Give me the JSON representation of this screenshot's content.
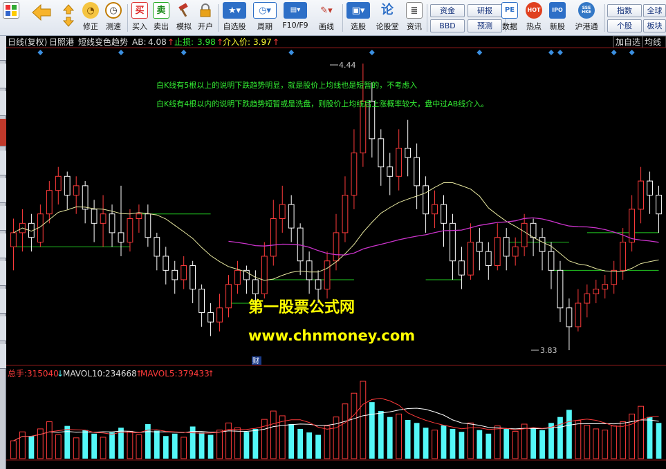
{
  "toolbar": {
    "buttons": [
      {
        "label": "",
        "icon": "window-icon"
      },
      {
        "label": "",
        "icon": "back-icon"
      },
      {
        "label": "修正",
        "icon": "up-down-icon"
      },
      {
        "label": "测速",
        "icon": "speed-icon"
      },
      {
        "label": "",
        "icon": "clock-icon"
      },
      {
        "label": "买入",
        "icon": "buy-icon"
      },
      {
        "label": "卖出",
        "icon": "sell-icon"
      },
      {
        "label": "模拟",
        "icon": "hammer-icon"
      },
      {
        "label": "开户",
        "icon": "lock-icon"
      },
      {
        "label": "自选股",
        "icon": "star-icon"
      },
      {
        "label": "周期",
        "icon": "period-icon"
      },
      {
        "label": "F10/F9",
        "icon": "f10-icon"
      },
      {
        "label": "画线",
        "icon": "pen-icon"
      },
      {
        "label": "选股",
        "icon": "select-icon"
      },
      {
        "label": "论股堂",
        "icon": "forum-icon"
      },
      {
        "label": "资讯",
        "icon": "news-icon"
      },
      {
        "label": "数据",
        "icon": "pe-icon"
      },
      {
        "label": "热点",
        "icon": "hot-icon"
      },
      {
        "label": "新股",
        "icon": "ipo-icon"
      },
      {
        "label": "沪港通",
        "icon": "sse-hke-icon"
      }
    ],
    "small_buttons": [
      "资金",
      "BBD",
      "研报",
      "预测",
      "指数",
      "个股",
      "全球",
      "板块"
    ],
    "icon_texts": {
      "buy": "买",
      "sell": "卖",
      "forum": "论",
      "pe": "PE",
      "ipo": "IPO",
      "hot": "HOT",
      "sse": "SSE HKE"
    }
  },
  "chart_header": {
    "period": "日线(复权)",
    "stock": "日照港",
    "formula": "短线变色趋势",
    "ab_label": "AB:",
    "ab_value": "4.08",
    "stop_label": "止损:",
    "stop_value": "3.98",
    "entry_label": "介入价:",
    "entry_value": "3.97",
    "right_tabs": [
      "加自选",
      "均线"
    ]
  },
  "annotations": {
    "line1": "白K线有5根以上的说明下跌趋势明显，就是股价上均线也是短暂的，不考虑入",
    "line2": "白K线有4根以内的说明下跌趋势短暂或是洗盘，则股价上均线后上涨概率较大，盘中过AB线介入。",
    "high_label": "4.44",
    "low_label": "3.83",
    "watermark_cn": "第一股票公式网",
    "watermark_url": "www.chnmoney.com",
    "cai_badge": "财"
  },
  "volume_header": {
    "vol_label": "总手:",
    "vol_value": "315040",
    "mavol10_label": "MAVOL10:",
    "mavol10_value": "234668",
    "mavol5_label": "MAVOL5:",
    "mavol5_value": "379433"
  },
  "colors": {
    "up": "#ff3b3b",
    "down": "#ffffff",
    "ma_long": "#e8e8a0",
    "ma_purple": "#cc33cc",
    "ab_line": "#22cc22",
    "vol_up": "#ff3b3b",
    "vol_down": "#54f7f7",
    "diamond": "#3b8fe0",
    "annotation_text": "#33ee33",
    "watermark_cn": "#ffff00",
    "watermark_url": "#ffff00"
  },
  "chart_data": {
    "type": "candlestick",
    "price_range": [
      3.83,
      4.44
    ],
    "candles": [
      [
        4.05,
        4.08,
        4.0,
        4.11
      ],
      [
        4.08,
        4.1,
        4.04,
        4.13
      ],
      [
        4.1,
        4.07,
        4.04,
        4.12
      ],
      [
        4.06,
        4.12,
        4.05,
        4.14
      ],
      [
        4.12,
        4.17,
        4.1,
        4.19
      ],
      [
        4.17,
        4.2,
        4.14,
        4.22
      ],
      [
        4.2,
        4.16,
        4.13,
        4.21
      ],
      [
        4.16,
        4.18,
        4.12,
        4.2
      ],
      [
        4.18,
        4.13,
        4.1,
        4.19
      ],
      [
        4.13,
        4.1,
        4.06,
        4.15
      ],
      [
        4.1,
        4.12,
        4.05,
        4.16
      ],
      [
        4.12,
        4.08,
        4.05,
        4.14
      ],
      [
        4.08,
        4.06,
        4.03,
        4.18
      ],
      [
        4.06,
        4.11,
        4.04,
        4.13
      ],
      [
        4.11,
        4.12,
        4.08,
        4.14
      ],
      [
        4.12,
        4.07,
        4.05,
        4.14
      ],
      [
        4.07,
        4.03,
        4.0,
        4.08
      ],
      [
        4.03,
        4.0,
        3.97,
        4.05
      ],
      [
        4.0,
        3.98,
        3.95,
        4.02
      ],
      [
        3.98,
        4.01,
        3.96,
        4.03
      ],
      [
        4.01,
        3.96,
        3.93,
        4.02
      ],
      [
        3.96,
        3.91,
        3.88,
        3.97
      ],
      [
        3.91,
        3.89,
        3.86,
        3.93
      ],
      [
        3.89,
        3.92,
        3.87,
        3.95
      ],
      [
        3.92,
        3.97,
        3.9,
        3.99
      ],
      [
        3.97,
        4.0,
        3.95,
        4.02
      ],
      [
        4.0,
        3.98,
        3.95,
        4.01
      ],
      [
        3.98,
        3.95,
        3.92,
        4.0
      ],
      [
        3.95,
        4.03,
        3.94,
        4.06
      ],
      [
        4.03,
        4.11,
        4.01,
        4.15
      ],
      [
        4.11,
        4.14,
        4.08,
        4.18
      ],
      [
        4.14,
        4.09,
        4.06,
        4.16
      ],
      [
        4.09,
        4.02,
        3.99,
        4.1
      ],
      [
        4.02,
        3.98,
        3.95,
        4.04
      ],
      [
        3.98,
        3.96,
        3.93,
        4.0
      ],
      [
        3.96,
        4.02,
        3.94,
        4.04
      ],
      [
        4.02,
        4.08,
        4.0,
        4.12
      ],
      [
        4.08,
        4.16,
        4.06,
        4.2
      ],
      [
        4.16,
        4.25,
        4.13,
        4.3
      ],
      [
        4.25,
        4.36,
        4.22,
        4.44
      ],
      [
        4.36,
        4.28,
        4.24,
        4.4
      ],
      [
        4.28,
        4.22,
        4.18,
        4.3
      ],
      [
        4.22,
        4.2,
        4.16,
        4.25
      ],
      [
        4.2,
        4.26,
        4.17,
        4.3
      ],
      [
        4.26,
        4.24,
        4.2,
        4.32
      ],
      [
        4.24,
        4.18,
        4.13,
        4.27
      ],
      [
        4.18,
        4.12,
        4.08,
        4.2
      ],
      [
        4.12,
        4.14,
        4.09,
        4.17
      ],
      [
        4.14,
        4.1,
        4.05,
        4.16
      ],
      [
        4.1,
        4.02,
        3.98,
        4.12
      ],
      [
        4.02,
        3.99,
        3.96,
        4.05
      ],
      [
        3.99,
        4.06,
        3.98,
        4.1
      ],
      [
        4.06,
        4.04,
        4.0,
        4.09
      ],
      [
        4.04,
        4.01,
        3.98,
        4.06
      ],
      [
        4.01,
        4.07,
        4.0,
        4.1
      ],
      [
        4.07,
        4.03,
        4.0,
        4.09
      ],
      [
        4.03,
        4.05,
        4.01,
        4.07
      ],
      [
        4.05,
        4.1,
        4.03,
        4.12
      ],
      [
        4.1,
        4.07,
        4.03,
        4.11
      ],
      [
        4.07,
        4.04,
        4.0,
        4.09
      ],
      [
        4.04,
        4.0,
        3.96,
        4.06
      ],
      [
        4.0,
        3.92,
        3.89,
        4.02
      ],
      [
        3.92,
        3.88,
        3.83,
        3.94
      ],
      [
        3.88,
        3.93,
        3.87,
        3.96
      ],
      [
        3.93,
        3.95,
        3.9,
        3.97
      ],
      [
        3.95,
        3.96,
        3.93,
        3.98
      ],
      [
        3.96,
        3.97,
        3.94,
        3.99
      ],
      [
        3.97,
        4.0,
        3.95,
        4.02
      ],
      [
        4.0,
        4.06,
        3.98,
        4.09
      ],
      [
        4.06,
        4.13,
        4.04,
        4.16
      ],
      [
        4.13,
        4.19,
        4.1,
        4.22
      ],
      [
        4.19,
        4.16,
        4.12,
        4.21
      ],
      [
        4.16,
        4.12,
        4.08,
        4.18
      ]
    ],
    "volumes": [
      30,
      45,
      38,
      50,
      62,
      40,
      55,
      35,
      48,
      42,
      36,
      44,
      52,
      46,
      40,
      58,
      47,
      38,
      42,
      36,
      54,
      44,
      40,
      48,
      60,
      52,
      45,
      50,
      66,
      80,
      72,
      58,
      50,
      44,
      40,
      55,
      70,
      92,
      110,
      130,
      95,
      80,
      70,
      75,
      65,
      60,
      52,
      48,
      56,
      50,
      45,
      60,
      48,
      42,
      55,
      50,
      46,
      58,
      52,
      48,
      60,
      70,
      82,
      64,
      56,
      50,
      48,
      55,
      62,
      75,
      88,
      70,
      60
    ],
    "volume_up_flags": [
      1,
      1,
      0,
      1,
      1,
      1,
      0,
      1,
      0,
      0,
      1,
      0,
      0,
      1,
      1,
      0,
      0,
      0,
      0,
      1,
      0,
      0,
      0,
      1,
      1,
      1,
      0,
      0,
      1,
      1,
      1,
      0,
      0,
      0,
      0,
      1,
      1,
      1,
      1,
      1,
      0,
      0,
      0,
      1,
      0,
      0,
      0,
      1,
      0,
      0,
      0,
      1,
      0,
      0,
      1,
      0,
      1,
      1,
      0,
      0,
      0,
      0,
      0,
      1,
      1,
      1,
      1,
      1,
      1,
      1,
      1,
      0,
      0
    ]
  }
}
